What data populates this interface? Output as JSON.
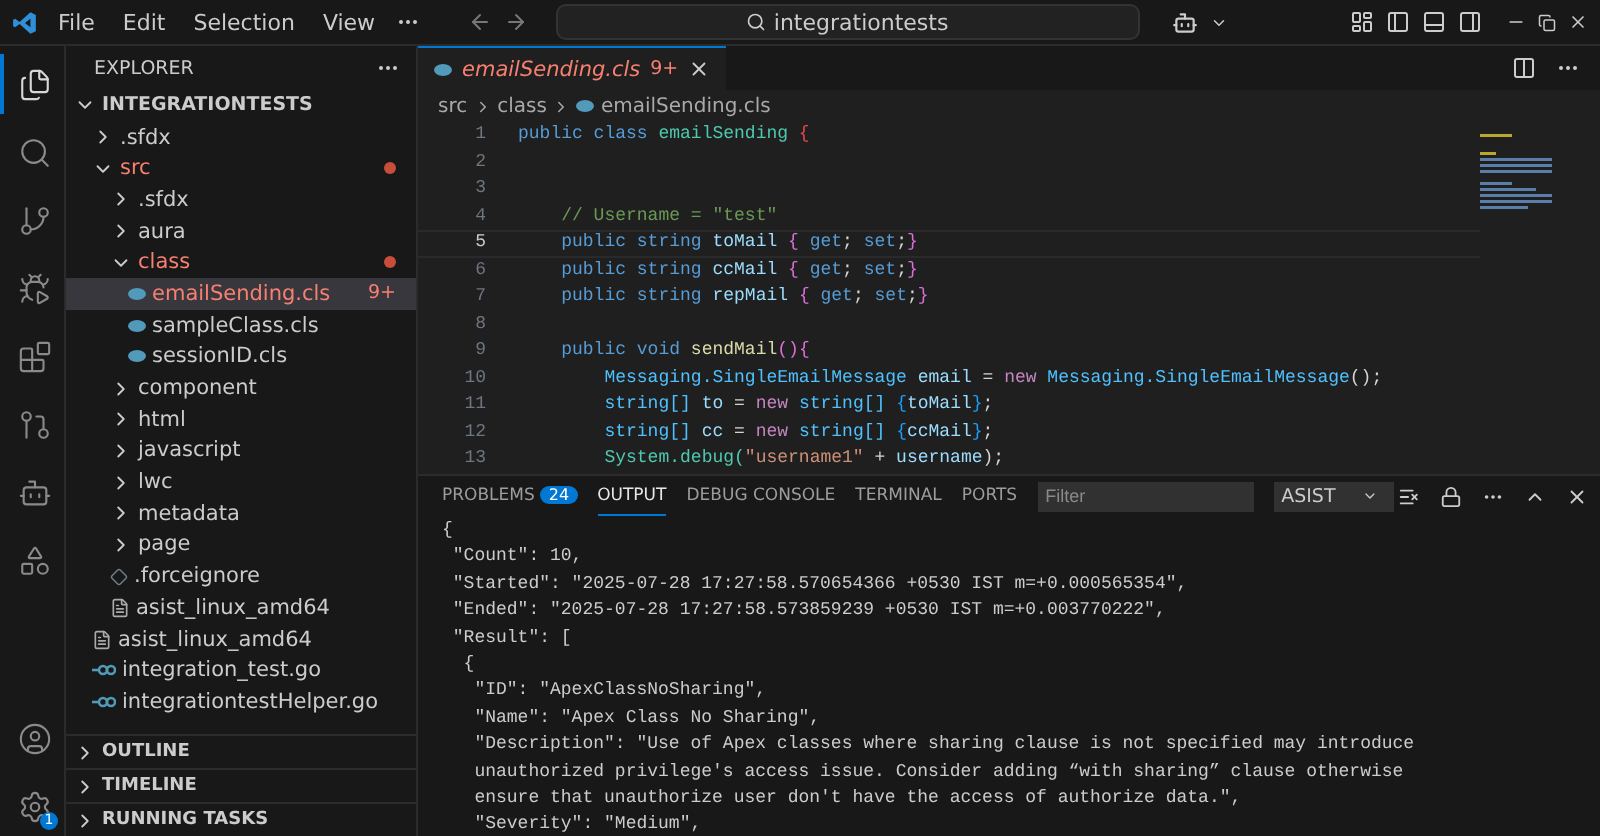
{
  "menu": [
    "File",
    "Edit",
    "Selection",
    "View"
  ],
  "command_center": {
    "value": "integrationtests"
  },
  "activity_bar": [
    {
      "kind": "files",
      "selected": true
    },
    {
      "kind": "search",
      "selected": false
    },
    {
      "kind": "source-control",
      "selected": false
    },
    {
      "kind": "run-debug",
      "selected": false
    },
    {
      "kind": "extensions",
      "selected": false
    },
    {
      "kind": "git-graph",
      "selected": false
    },
    {
      "kind": "robot",
      "selected": false
    },
    {
      "kind": "shapes",
      "selected": false
    }
  ],
  "activity_bottom": {
    "settings_badge": "1"
  },
  "sidebar": {
    "title": "EXPLORER",
    "tree": {
      "name": "INTEGRATIONTESTS",
      "expanded": true,
      "children": [
        {
          "name": ".sfdx",
          "kind": "folder",
          "expanded": false,
          "problems": false,
          "dot": false,
          "selected": false
        },
        {
          "name": "src",
          "kind": "folder",
          "expanded": true,
          "problems": true,
          "dot": true,
          "selected": false,
          "children": [
            {
              "name": ".sfdx",
              "kind": "folder",
              "expanded": false,
              "problems": false,
              "dot": false,
              "selected": false
            },
            {
              "name": "aura",
              "kind": "folder",
              "expanded": false,
              "problems": false,
              "dot": false,
              "selected": false
            },
            {
              "name": "class",
              "kind": "folder",
              "expanded": true,
              "problems": true,
              "dot": true,
              "selected": false,
              "children": [
                {
                  "name": "emailSending.cls",
                  "kind": "apex",
                  "problems": true,
                  "dot": false,
                  "badge": "9+",
                  "selected": true
                },
                {
                  "name": "sampleClass.cls",
                  "kind": "apex",
                  "problems": false,
                  "dot": false,
                  "selected": false
                },
                {
                  "name": "sessionID.cls",
                  "kind": "apex",
                  "problems": false,
                  "dot": false,
                  "selected": false
                }
              ]
            },
            {
              "name": "component",
              "kind": "folder",
              "expanded": false,
              "problems": false,
              "dot": false,
              "selected": false
            },
            {
              "name": "html",
              "kind": "folder",
              "expanded": false,
              "problems": false,
              "dot": false,
              "selected": false
            },
            {
              "name": "javascript",
              "kind": "folder",
              "expanded": false,
              "problems": false,
              "dot": false,
              "selected": false
            },
            {
              "name": "lwc",
              "kind": "folder",
              "expanded": false,
              "problems": false,
              "dot": false,
              "selected": false
            },
            {
              "name": "metadata",
              "kind": "folder",
              "expanded": false,
              "problems": false,
              "dot": false,
              "selected": false
            },
            {
              "name": "page",
              "kind": "folder",
              "expanded": false,
              "problems": false,
              "dot": false,
              "selected": false
            },
            {
              "name": ".forceignore",
              "kind": "ignore",
              "problems": false,
              "dot": false,
              "selected": false
            },
            {
              "name": "asist_linux_amd64",
              "kind": "binary",
              "problems": false,
              "dot": false,
              "selected": false
            }
          ]
        },
        {
          "name": "asist_linux_amd64",
          "kind": "binary",
          "problems": false,
          "dot": false,
          "selected": false
        },
        {
          "name": "integration_test.go",
          "kind": "go",
          "problems": false,
          "dot": false,
          "selected": false
        },
        {
          "name": "integrationtestHelper.go",
          "kind": "go",
          "problems": false,
          "dot": false,
          "selected": false
        }
      ]
    },
    "sections": [
      "OUTLINE",
      "TIMELINE",
      "RUNNING TASKS"
    ]
  },
  "editor": {
    "tab": {
      "title": "emailSending.cls",
      "badge": "9+",
      "problems": true
    },
    "breadcrumbs": [
      "src",
      "class",
      "emailSending.cls"
    ],
    "lines": [
      {
        "number": "1",
        "current": false,
        "tokens": [
          {
            "text": "public class ",
            "kind": "kw"
          },
          {
            "text": "emailSending",
            "kind": "cls"
          },
          {
            "text": " {",
            "kind": "brace1"
          }
        ]
      },
      {
        "number": "2",
        "current": false
      },
      {
        "number": "3",
        "current": false
      },
      {
        "number": "4",
        "current": false,
        "tokens": [
          {
            "text": "    // Username = \"test\"",
            "kind": "comment"
          }
        ]
      },
      {
        "number": "5",
        "current": true,
        "tokens": [
          {
            "text": "    public string ",
            "kind": "kw"
          },
          {
            "text": "toMail ",
            "kind": "ident"
          },
          {
            "text": "{",
            "kind": "brace2"
          },
          {
            "text": " get",
            "kind": "kw"
          },
          {
            "text": "; ",
            "kind": "plain"
          },
          {
            "text": "set",
            "kind": "kw"
          },
          {
            "text": ";",
            "kind": "plain"
          },
          {
            "text": "}",
            "kind": "brace2"
          }
        ]
      },
      {
        "number": "6",
        "current": false,
        "tokens": [
          {
            "text": "    public string ",
            "kind": "kw"
          },
          {
            "text": "ccMail ",
            "kind": "ident"
          },
          {
            "text": "{",
            "kind": "brace2"
          },
          {
            "text": " get",
            "kind": "kw"
          },
          {
            "text": "; ",
            "kind": "plain"
          },
          {
            "text": "set",
            "kind": "kw"
          },
          {
            "text": ";",
            "kind": "plain"
          },
          {
            "text": "}",
            "kind": "brace2"
          }
        ]
      },
      {
        "number": "7",
        "current": false,
        "tokens": [
          {
            "text": "    public string ",
            "kind": "kw"
          },
          {
            "text": "repMail ",
            "kind": "ident"
          },
          {
            "text": "{",
            "kind": "brace2"
          },
          {
            "text": " get",
            "kind": "kw"
          },
          {
            "text": "; ",
            "kind": "plain"
          },
          {
            "text": "set",
            "kind": "kw"
          },
          {
            "text": ";",
            "kind": "plain"
          },
          {
            "text": "}",
            "kind": "brace2"
          }
        ]
      },
      {
        "number": "8",
        "current": false
      },
      {
        "number": "9",
        "current": false,
        "tokens": [
          {
            "text": "    public void ",
            "kind": "kw"
          },
          {
            "text": "sendMail",
            "kind": "fn"
          },
          {
            "text": "(){",
            "kind": "brace2"
          }
        ]
      },
      {
        "number": "10",
        "current": false,
        "tokens": [
          {
            "text": "        Messaging.SingleEmailMessage ",
            "kind": "type"
          },
          {
            "text": "email",
            "kind": "ident"
          },
          {
            "text": " = ",
            "kind": "plain"
          },
          {
            "text": "new",
            "kind": "ctl"
          },
          {
            "text": " Messaging.SingleEmailMessage",
            "kind": "type"
          },
          {
            "text": "();",
            "kind": "plain"
          }
        ]
      },
      {
        "number": "11",
        "current": false,
        "tokens": [
          {
            "text": "        string[] ",
            "kind": "type"
          },
          {
            "text": "to",
            "kind": "ident"
          },
          {
            "text": " = ",
            "kind": "plain"
          },
          {
            "text": "new",
            "kind": "ctl"
          },
          {
            "text": " string[] ",
            "kind": "type"
          },
          {
            "text": "{",
            "kind": "brace3"
          },
          {
            "text": "toMail",
            "kind": "ident"
          },
          {
            "text": "}",
            "kind": "brace3"
          },
          {
            "text": ";",
            "kind": "plain"
          }
        ]
      },
      {
        "number": "12",
        "current": false,
        "tokens": [
          {
            "text": "        string[] ",
            "kind": "type"
          },
          {
            "text": "cc",
            "kind": "ident"
          },
          {
            "text": " = ",
            "kind": "plain"
          },
          {
            "text": "new",
            "kind": "ctl"
          },
          {
            "text": " string[] ",
            "kind": "type"
          },
          {
            "text": "{",
            "kind": "brace3"
          },
          {
            "text": "ccMail",
            "kind": "ident"
          },
          {
            "text": "}",
            "kind": "brace3"
          },
          {
            "text": ";",
            "kind": "plain"
          }
        ]
      },
      {
        "number": "13",
        "current": false,
        "tokens": [
          {
            "text": "        System.debug(",
            "kind": "cls"
          },
          {
            "text": "\"username1\"",
            "kind": "str"
          },
          {
            "text": " + ",
            "kind": "plain"
          },
          {
            "text": "username",
            "kind": "ident"
          },
          {
            "text": ");",
            "kind": "plain"
          }
        ]
      }
    ]
  },
  "panel": {
    "tabs": [
      {
        "label": "PROBLEMS",
        "badge": "24",
        "selected": false
      },
      {
        "label": "OUTPUT",
        "selected": true
      },
      {
        "label": "DEBUG CONSOLE",
        "selected": false
      },
      {
        "label": "TERMINAL",
        "selected": false
      },
      {
        "label": "PORTS",
        "selected": false
      }
    ],
    "filter": {
      "placeholder": "Filter"
    },
    "channel": "ASIST",
    "output": [
      "{",
      " \"Count\": 10,",
      " \"Started\": \"2025-07-28 17:27:58.570654366 +0530 IST m=+0.000565354\",",
      " \"Ended\": \"2025-07-28 17:27:58.573859239 +0530 IST m=+0.003770222\",",
      " \"Result\": [",
      "  {",
      "   \"ID\": \"ApexClassNoSharing\",",
      "   \"Name\": \"Apex Class No Sharing\",",
      "   \"Description\": \"Use of Apex classes where sharing clause is not specified may introduce",
      "   unauthorized privilege's access issue. Consider adding “with sharing” clause otherwise",
      "   ensure that unauthorize user don't have the access of authorize data.\",",
      "   \"Severity\": \"Medium\","
    ]
  }
}
